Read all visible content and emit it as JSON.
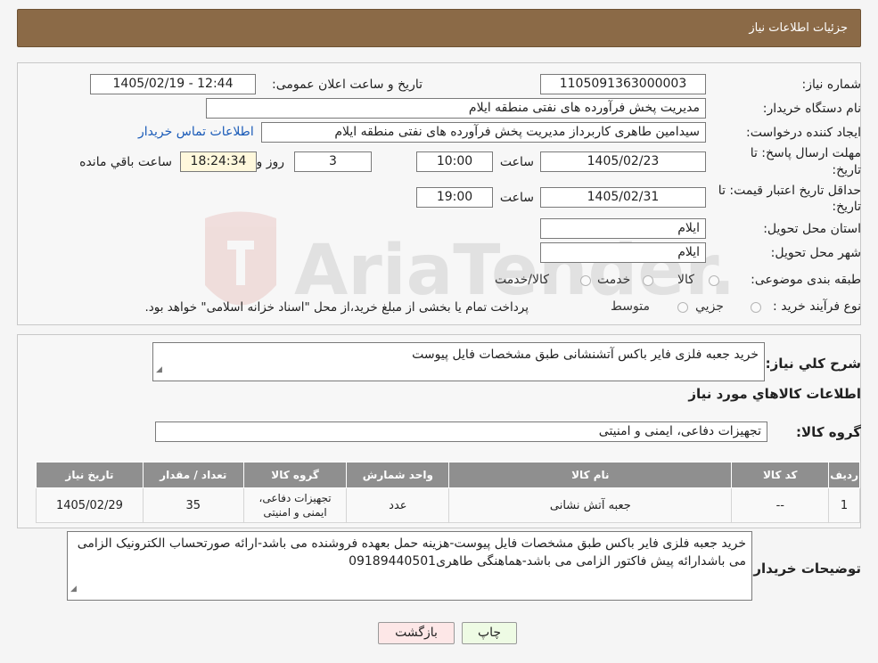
{
  "header": {
    "title": "جزئیات اطلاعات نیاز"
  },
  "info": {
    "need_number_label": "شماره نیاز:",
    "need_number": "1105091363000003",
    "announce_label": "تاریخ و ساعت اعلان عمومی:",
    "announce_value": "1405/02/19 - 12:44",
    "buyer_label": "نام دستگاه خریدار:",
    "buyer_value": "مدیریت پخش فرآورده های نفتی منطقه ایلام",
    "creator_label": "ایجاد کننده درخواست:",
    "creator_value": "سیدامین طاهری کاربرداز مدیریت پخش فرآورده های نفتی منطقه ایلام",
    "contact_link": "اطلاعات تماس خریدار",
    "deadline_label_1": "مهلت ارسال پاسخ: تا",
    "deadline_label_2": "تاریخ:",
    "deadline_date": "1405/02/23",
    "time_label": "ساعت",
    "deadline_time": "10:00",
    "days_value": "3",
    "days_label": "روز و",
    "remaining_time": "18:24:34",
    "remaining_label": "ساعت باقي مانده",
    "validity_label_1": "حداقل تاریخ اعتبار قیمت: تا",
    "validity_label_2": "تاریخ:",
    "validity_date": "1405/02/31",
    "validity_time": "19:00",
    "province_label": "استان محل تحویل:",
    "province_value": "ایلام",
    "city_label": "شهر محل تحویل:",
    "city_value": "ایلام",
    "category_label": "طبقه بندی موضوعی:",
    "category_options": [
      "کالا",
      "خدمت",
      "کالا/خدمت"
    ],
    "process_label": "نوع فرآیند خرید :",
    "process_options": [
      "جزیي",
      "متوسط"
    ],
    "process_note": "پرداخت تمام یا بخشی از مبلغ خرید،از محل \"اسناد خزانه اسلامی\" خواهد بود."
  },
  "summary": {
    "desc_label": "شرح کلي نیاز:",
    "desc_value": "خرید جعبه فلزی فایر باکس  آتشنشانی طبق مشخصات فایل پیوست",
    "goods_info_title": "اطلاعات کالاهاي مورد نیاز",
    "group_label": "گروه کالا:",
    "group_value": "تجهیزات دفاعی، ایمنی و امنیتی"
  },
  "table": {
    "headers": [
      "ردیف",
      "کد کالا",
      "نام کالا",
      "واحد شمارش",
      "گروه کالا",
      "تعداد / مقدار",
      "تاریخ نیاز"
    ],
    "rows": [
      [
        "1",
        "--",
        "جعبه آتش نشانی",
        "عدد",
        "تجهیزات دفاعی، ایمنی و امنیتی",
        "35",
        "1405/02/29"
      ]
    ]
  },
  "buyer_notes": {
    "label": "توضیحات خریدار:",
    "value": "خرید جعبه فلزی فایر باکس طبق مشخصات فایل پیوست-هزینه حمل بعهده فروشنده می باشد-ارائه صورتحساب الکترونیک الزامی می باشدارائه پیش فاکتور الزامی می باشد-هماهنگی طاهری09189440501"
  },
  "buttons": {
    "print": "چاپ",
    "back": "بازگشت"
  },
  "watermark": "AriaTender.neT",
  "colors": {
    "header_bg": "#8b6a47",
    "print_btn": "#eefbe4",
    "back_btn": "#fde7e7"
  }
}
